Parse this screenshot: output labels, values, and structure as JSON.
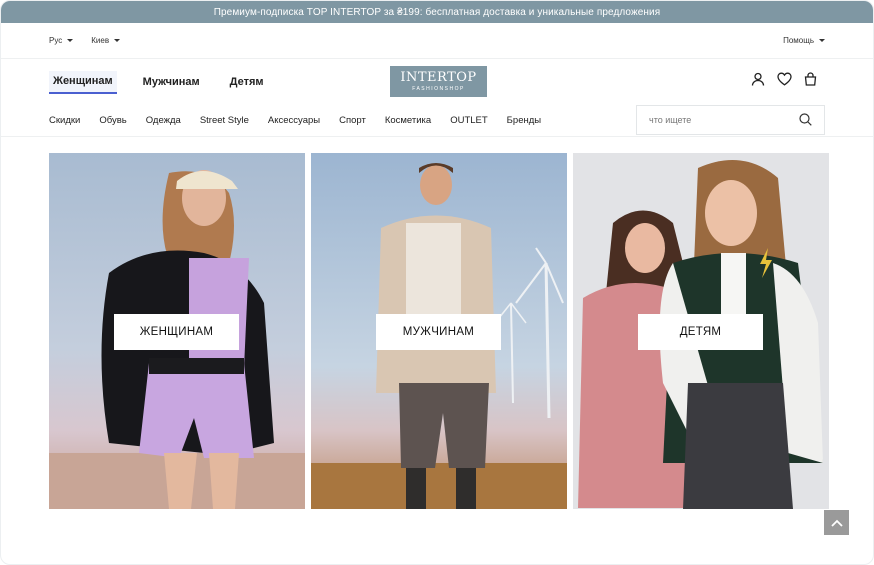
{
  "promo": {
    "text": "Премиум-подписка TOP INTERTOP за ₴199: бесплатная доставка и уникальные предложения"
  },
  "utility": {
    "language": "Рус",
    "city": "Киев",
    "help": "Помощь"
  },
  "gender_tabs": [
    {
      "label": "Женщинам",
      "active": true
    },
    {
      "label": "Мужчинам",
      "active": false
    },
    {
      "label": "Детям",
      "active": false
    }
  ],
  "logo": {
    "main": "INTERTOP",
    "sub": "FASHIONSHOP"
  },
  "header_icons": [
    "user-icon",
    "heart-icon",
    "bag-icon"
  ],
  "categories": [
    "Скидки",
    "Обувь",
    "Одежда",
    "Street Style",
    "Аксессуары",
    "Спорт",
    "Косметика",
    "OUTLET",
    "Бренды"
  ],
  "search": {
    "placeholder": "что ищете",
    "value": ""
  },
  "cards": [
    {
      "label": "ЖЕНЩИНАМ"
    },
    {
      "label": "МУЖЧИНАМ"
    },
    {
      "label": "ДЕТЯМ"
    }
  ],
  "colors": {
    "brand": "#7f97a3",
    "active_tab_underline": "#4a5fd0",
    "scroll_top_bg": "#9a9a9a"
  }
}
